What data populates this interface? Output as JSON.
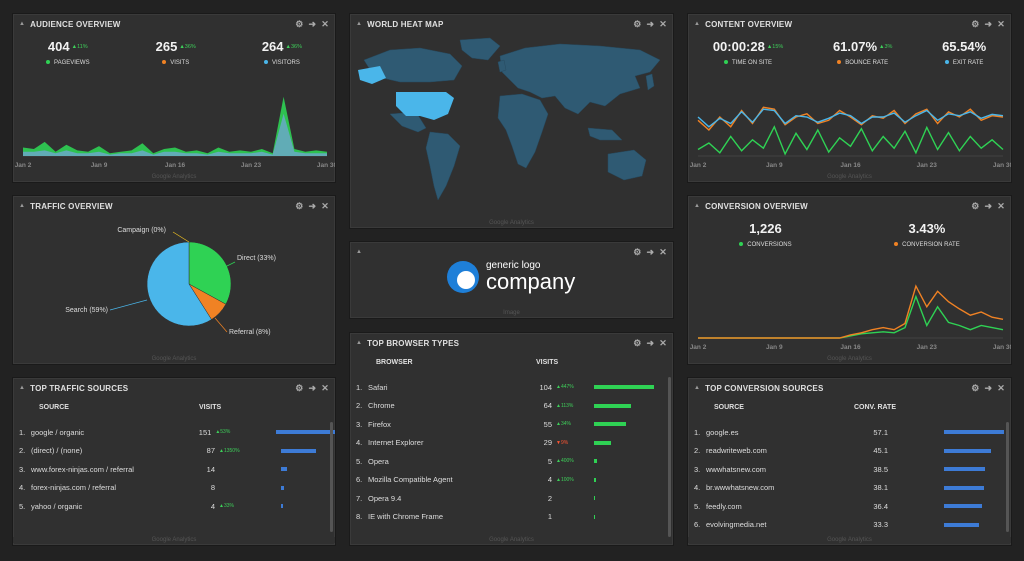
{
  "widgets": {
    "audience": {
      "title": "AUDIENCE OVERVIEW",
      "footer": "Google Analytics",
      "kpis": [
        {
          "value": "404",
          "delta": "▲11%",
          "label": "PAGEVIEWS",
          "color": "#2fd254"
        },
        {
          "value": "265",
          "delta": "▲36%",
          "label": "VISITS",
          "color": "#f08224"
        },
        {
          "value": "264",
          "delta": "▲36%",
          "label": "VISITORS",
          "color": "#4ab6ea"
        }
      ],
      "x_labels": [
        "Jan 2",
        "Jan 9",
        "Jan 16",
        "Jan 23",
        "Jan 30"
      ],
      "chart_data": {
        "type": "area",
        "x": [
          2,
          3,
          4,
          5,
          6,
          7,
          8,
          9,
          10,
          11,
          12,
          13,
          14,
          15,
          16,
          17,
          18,
          19,
          20,
          21,
          22,
          23,
          24,
          25,
          26,
          27,
          28,
          29,
          30
        ],
        "series": [
          {
            "values": [
              6,
              5,
              10,
              3,
              8,
              4,
              3,
              7,
              2,
              3,
              4,
              9,
              2,
              5,
              6,
              3,
              4,
              2,
              6,
              3,
              4,
              3,
              5,
              2,
              42,
              5,
              3,
              4,
              3
            ]
          },
          {
            "values": [
              3,
              3,
              4,
              2,
              4,
              2,
              2,
              3,
              1,
              2,
              2,
              4,
              1,
              3,
              3,
              2,
              2,
              1,
              3,
              2,
              2,
              2,
              3,
              1,
              30,
              3,
              2,
              2,
              2
            ]
          }
        ]
      }
    },
    "heatmap": {
      "title": "WORLD HEAT MAP",
      "footer": "Google Analytics"
    },
    "content": {
      "title": "CONTENT OVERVIEW",
      "footer": "Google Analytics",
      "kpis": [
        {
          "value": "00:00:28",
          "delta": "▲15%",
          "label": "TIME ON SITE",
          "color": "#2fd254"
        },
        {
          "value": "61.07%",
          "delta": "▲3%",
          "label": "BOUNCE RATE",
          "color": "#f08224"
        },
        {
          "value": "65.54%",
          "delta": "",
          "label": "EXIT RATE",
          "color": "#4ab6ea"
        }
      ],
      "x_labels": [
        "Jan 2",
        "Jan 9",
        "Jan 16",
        "Jan 23",
        "Jan 30"
      ],
      "chart_data": {
        "type": "line",
        "x": [
          2,
          3,
          4,
          5,
          6,
          7,
          8,
          9,
          10,
          11,
          12,
          13,
          14,
          15,
          16,
          17,
          18,
          19,
          20,
          21,
          22,
          23,
          24,
          25,
          26,
          27,
          28,
          29,
          30
        ],
        "series": [
          {
            "values": [
              10,
              20,
              5,
              30,
              8,
              25,
              12,
              45,
              3,
              35,
              10,
              40,
              6,
              28,
              15,
              42,
              8,
              30,
              12,
              38,
              5,
              44,
              10,
              36,
              8,
              30,
              12,
              25,
              10
            ]
          },
          {
            "values": [
              55,
              40,
              60,
              45,
              70,
              50,
              75,
              72,
              48,
              60,
              65,
              50,
              55,
              70,
              60,
              48,
              62,
              58,
              70,
              50,
              65,
              72,
              50,
              68,
              60,
              72,
              55,
              62,
              60
            ]
          },
          {
            "values": [
              60,
              45,
              58,
              50,
              68,
              52,
              72,
              70,
              50,
              62,
              60,
              52,
              58,
              66,
              62,
              50,
              60,
              60,
              66,
              52,
              62,
              70,
              55,
              65,
              62,
              68,
              58,
              64,
              62
            ]
          }
        ]
      }
    },
    "traffic": {
      "title": "TRAFFIC OVERVIEW",
      "footer": "Google Analytics",
      "chart_data": {
        "type": "pie",
        "slices": [
          {
            "label": "Direct (33%)",
            "value": 33,
            "color": "#2fd254"
          },
          {
            "label": "Referral (8%)",
            "value": 8,
            "color": "#f08224"
          },
          {
            "label": "Search (59%)",
            "value": 59,
            "color": "#4ab6ea"
          },
          {
            "label": "Campaign (0%)",
            "value": 0,
            "color": "#f0c020"
          }
        ]
      }
    },
    "logo": {
      "brand_small": "generic logo",
      "brand_big": "company",
      "footer": "Image"
    },
    "conversion": {
      "title": "CONVERSION OVERVIEW",
      "footer": "Google Analytics",
      "kpis": [
        {
          "value": "1,226",
          "delta": "",
          "label": "CONVERSIONS",
          "color": "#2fd254"
        },
        {
          "value": "3.43%",
          "delta": "",
          "label": "CONVERSION RATE",
          "color": "#f08224"
        }
      ],
      "x_labels": [
        "Jan 2",
        "Jan 9",
        "Jan 16",
        "Jan 23",
        "Jan 30"
      ],
      "chart_data": {
        "type": "line",
        "x": [
          2,
          3,
          4,
          5,
          6,
          7,
          8,
          9,
          10,
          11,
          12,
          13,
          14,
          15,
          16,
          17,
          18,
          19,
          20,
          21,
          22,
          23,
          24,
          25,
          26,
          27,
          28,
          29,
          30
        ],
        "series": [
          {
            "values": [
              0,
              0,
              0,
              0,
              0,
              0,
              0,
              0,
              0,
              0,
              0,
              0,
              0,
              0,
              2,
              4,
              5,
              6,
              5,
              10,
              40,
              12,
              30,
              15,
              12,
              8,
              12,
              10,
              8
            ]
          },
          {
            "values": [
              0,
              0,
              0,
              0,
              0,
              0,
              0,
              0,
              0,
              0,
              0,
              0,
              0,
              0,
              3,
              5,
              8,
              10,
              8,
              14,
              50,
              30,
              45,
              35,
              28,
              22,
              25,
              20,
              18
            ]
          }
        ]
      }
    },
    "traffic_sources": {
      "title": "TOP TRAFFIC SOURCES",
      "footer": "Google Analytics",
      "col_source": "SOURCE",
      "col_visits": "VISITS",
      "rows": [
        {
          "idx": "1.",
          "name": "google / organic",
          "value": "151",
          "delta": "▲53%",
          "dir": "up",
          "bar": 151
        },
        {
          "idx": "2.",
          "name": "(direct) / (none)",
          "value": "87",
          "delta": "▲1350%",
          "dir": "up",
          "bar": 87
        },
        {
          "idx": "3.",
          "name": "www.forex-ninjas.com / referral",
          "value": "14",
          "delta": "",
          "dir": "",
          "bar": 14
        },
        {
          "idx": "4.",
          "name": "forex-ninjas.com / referral",
          "value": "8",
          "delta": "",
          "dir": "",
          "bar": 8
        },
        {
          "idx": "5.",
          "name": "yahoo / organic",
          "value": "4",
          "delta": "▲33%",
          "dir": "up",
          "bar": 4
        }
      ],
      "bar_max": 151
    },
    "browsers": {
      "title": "TOP BROWSER TYPES",
      "footer": "Google Analytics",
      "col_browser": "BROWSER",
      "col_visits": "VISITS",
      "rows": [
        {
          "idx": "1.",
          "name": "Safari",
          "value": "104",
          "delta": "▲447%",
          "dir": "up",
          "bar": 104
        },
        {
          "idx": "2.",
          "name": "Chrome",
          "value": "64",
          "delta": "▲113%",
          "dir": "up",
          "bar": 64
        },
        {
          "idx": "3.",
          "name": "Firefox",
          "value": "55",
          "delta": "▲34%",
          "dir": "up",
          "bar": 55
        },
        {
          "idx": "4.",
          "name": "Internet Explorer",
          "value": "29",
          "delta": "▼9%",
          "dir": "down",
          "bar": 29
        },
        {
          "idx": "5.",
          "name": "Opera",
          "value": "5",
          "delta": "▲400%",
          "dir": "up",
          "bar": 5
        },
        {
          "idx": "6.",
          "name": "Mozilla Compatible Agent",
          "value": "4",
          "delta": "▲100%",
          "dir": "up",
          "bar": 4
        },
        {
          "idx": "7.",
          "name": "Opera 9.4",
          "value": "2",
          "delta": "",
          "dir": "",
          "bar": 2
        },
        {
          "idx": "8.",
          "name": "IE with Chrome Frame",
          "value": "1",
          "delta": "",
          "dir": "",
          "bar": 1
        }
      ],
      "bar_max": 104
    },
    "conv_sources": {
      "title": "TOP CONVERSION SOURCES",
      "footer": "Google Analytics",
      "col_source": "SOURCE",
      "col_rate": "CONV. RATE",
      "rows": [
        {
          "idx": "1.",
          "name": "google.es",
          "value": "57.1",
          "bar": 57.1
        },
        {
          "idx": "2.",
          "name": "readwriteweb.com",
          "value": "45.1",
          "bar": 45.1
        },
        {
          "idx": "3.",
          "name": "wwwhatsnew.com",
          "value": "38.5",
          "bar": 38.5
        },
        {
          "idx": "4.",
          "name": "br.wwwhatsnew.com",
          "value": "38.1",
          "bar": 38.1
        },
        {
          "idx": "5.",
          "name": "feedly.com",
          "value": "36.4",
          "bar": 36.4
        },
        {
          "idx": "6.",
          "name": "evolvingmedia.net",
          "value": "33.3",
          "bar": 33.3
        }
      ],
      "bar_max": 57.1
    }
  },
  "icons": {
    "gear": "⚙",
    "arrow": "➜",
    "close": "✕",
    "collapse": "▲"
  }
}
